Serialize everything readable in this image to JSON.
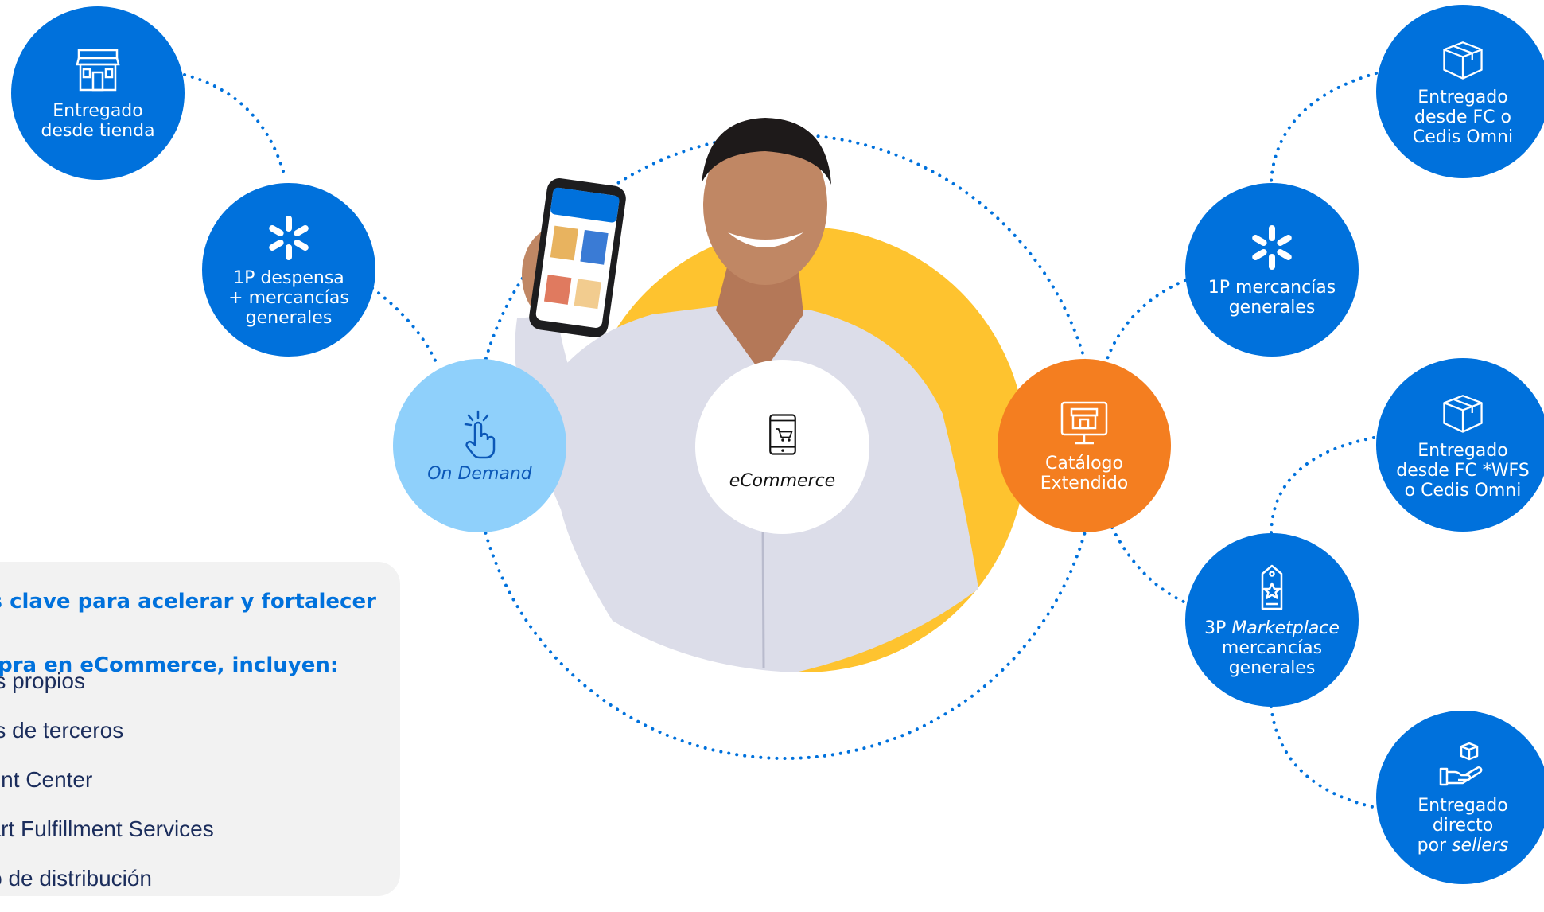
{
  "hub": {
    "label": "eCommerce",
    "icon": "mobile-cart-icon"
  },
  "on_demand": {
    "label": "On Demand",
    "icon": "tap-hand-icon"
  },
  "catalog": {
    "label": "Catálogo\nExtendido",
    "icon": "store-monitor-icon"
  },
  "left_nodes": [
    {
      "label": "Entregado\ndesde tienda",
      "icon": "store-icon"
    },
    {
      "label": "1P despensa\n+ mercancías\ngenerales",
      "icon": "walmart-spark-icon"
    }
  ],
  "right_nodes": [
    {
      "label": "Entregado\ndesde FC o\nCedis Omni",
      "icon": "box-icon"
    },
    {
      "label": "1P mercancías\ngenerales",
      "icon": "walmart-spark-icon"
    },
    {
      "label": "Entregado\ndesde FC *WFS\no Cedis Omni",
      "icon": "box-icon"
    },
    {
      "label_prefix": "3P ",
      "label_italic": "Marketplace",
      "label_rest": "mercancías\ngenerales",
      "icon": "tag-star-icon"
    },
    {
      "label_main": "Entregado\ndirecto\npor ",
      "label_italic": "sellers",
      "icon": "hand-box-icon"
    }
  ],
  "info_panel": {
    "heading": "as clave para acelerar y fortalecer la\nmpra en eCommerce, incluyen:",
    "items": [
      "tos propios",
      "tos de terceros",
      "nent Center",
      "nart Fulfillment Services",
      "tro de distribución"
    ]
  },
  "colors": {
    "blue": "#0071dc",
    "light_blue": "#8fd0fb",
    "orange": "#f47e20",
    "yellow": "#fec32f",
    "panel": "#f2f2f2"
  }
}
